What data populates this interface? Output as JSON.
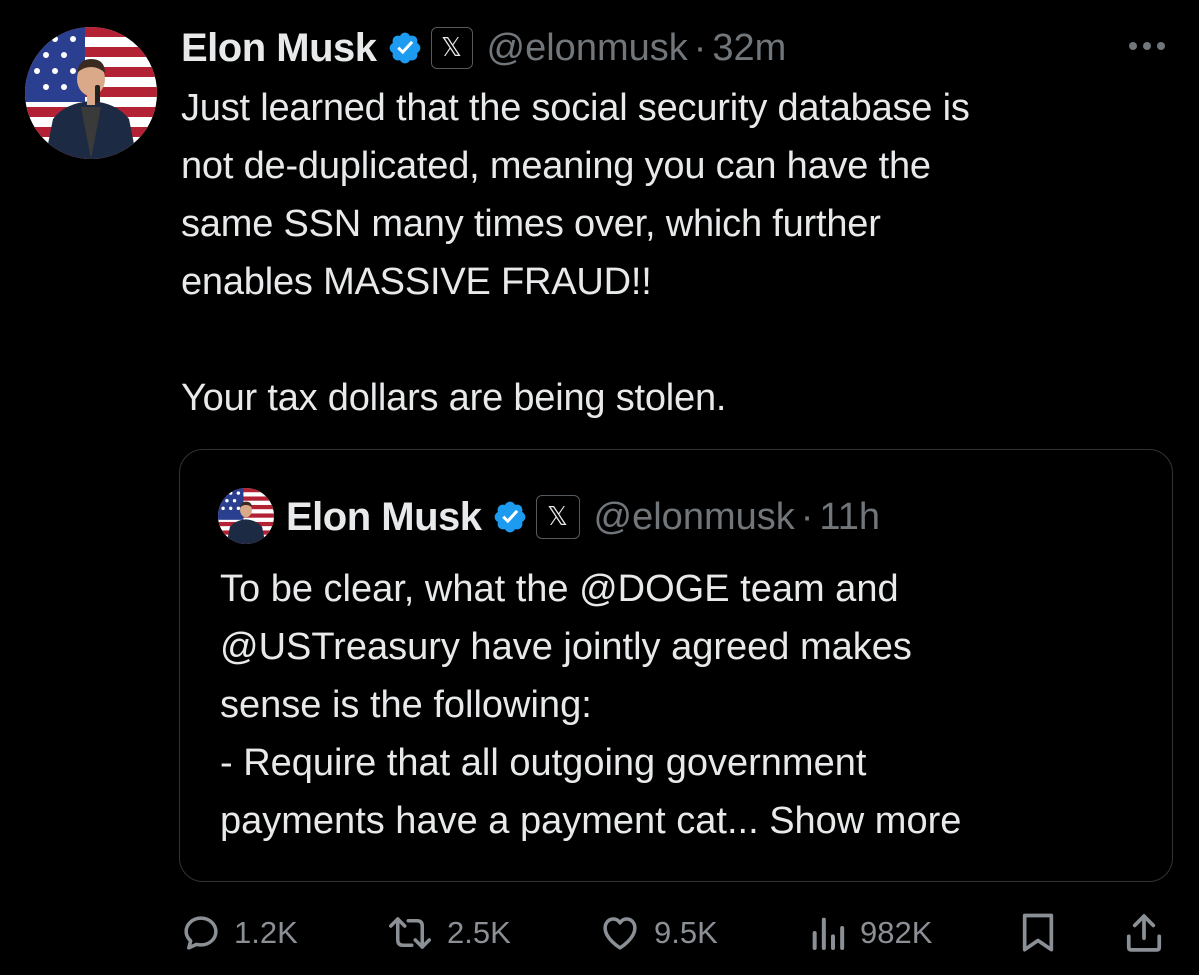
{
  "tweet": {
    "author_name": "Elon Musk",
    "x_badge": "𝕏",
    "handle": "@elonmusk",
    "separator": "·",
    "time": "32m",
    "body": [
      "Just learned that the social security database is",
      "not de-duplicated, meaning you can have the",
      "same SSN many times over, which further",
      "enables MASSIVE FRAUD!!",
      "",
      "Your tax dollars are being stolen."
    ]
  },
  "quote": {
    "author_name": "Elon Musk",
    "x_badge": "𝕏",
    "handle": "@elonmusk",
    "separator": "·",
    "time": "11h",
    "body": [
      "To be clear, what the @DOGE team and",
      "@USTreasury have jointly agreed makes",
      "sense is the following:",
      "- Require that all outgoing government",
      "payments have a payment cat..."
    ],
    "show_more": "Show more"
  },
  "actions": {
    "replies": "1.2K",
    "reposts": "2.5K",
    "likes": "9.5K",
    "views": "982K"
  },
  "icons": {
    "more": "more-horizontal-icon",
    "verified": "verified-badge-icon",
    "reply": "reply-icon",
    "repost": "repost-icon",
    "like": "heart-icon",
    "views": "views-icon",
    "bookmark": "bookmark-icon",
    "share": "share-icon"
  },
  "colors": {
    "background": "#000000",
    "text": "#e7e9ea",
    "muted": "#71767b",
    "verified": "#1d9bf0",
    "border": "#2f3336"
  }
}
